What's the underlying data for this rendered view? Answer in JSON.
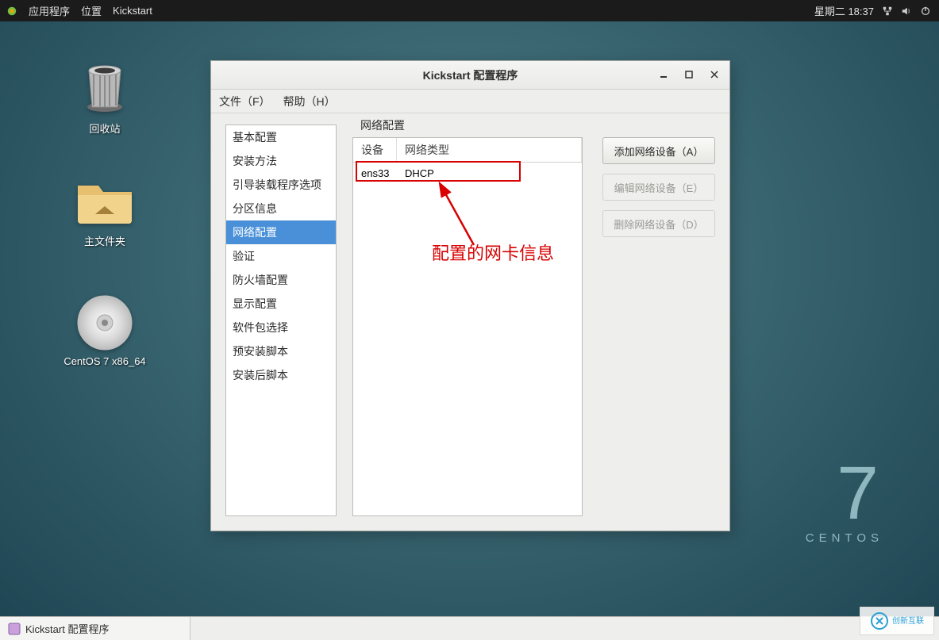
{
  "topbar": {
    "apps_label": "应用程序",
    "places_label": "位置",
    "active_app": "Kickstart",
    "datetime": "星期二 18:37"
  },
  "desktop_icons": {
    "trash": "回收站",
    "home": "主文件夹",
    "disc": "CentOS 7 x86_64"
  },
  "branding": {
    "digit": "7",
    "name": "CENTOS"
  },
  "window": {
    "title": "Kickstart 配置程序",
    "menu": {
      "file": "文件（F）",
      "help": "帮助（H）"
    }
  },
  "sidebar": {
    "items": [
      {
        "label": "基本配置"
      },
      {
        "label": "安装方法"
      },
      {
        "label": "引导装载程序选项"
      },
      {
        "label": "分区信息"
      },
      {
        "label": "网络配置"
      },
      {
        "label": "验证"
      },
      {
        "label": "防火墙配置"
      },
      {
        "label": "显示配置"
      },
      {
        "label": "软件包选择"
      },
      {
        "label": "预安装脚本"
      },
      {
        "label": "安装后脚本"
      }
    ],
    "selected_index": 4
  },
  "panel": {
    "group_label": "网络配置",
    "columns": {
      "c0": "设备",
      "c1": "网络类型"
    },
    "rows": [
      {
        "device": "ens33",
        "type": "DHCP"
      }
    ],
    "buttons": {
      "add": "添加网络设备（A）",
      "edit": "编辑网络设备（E）",
      "delete": "删除网络设备（D）"
    }
  },
  "annotation": {
    "label": "配置的网卡信息"
  },
  "taskbar": {
    "item0": "Kickstart 配置程序"
  },
  "watermark": {
    "text": "创新互联"
  }
}
